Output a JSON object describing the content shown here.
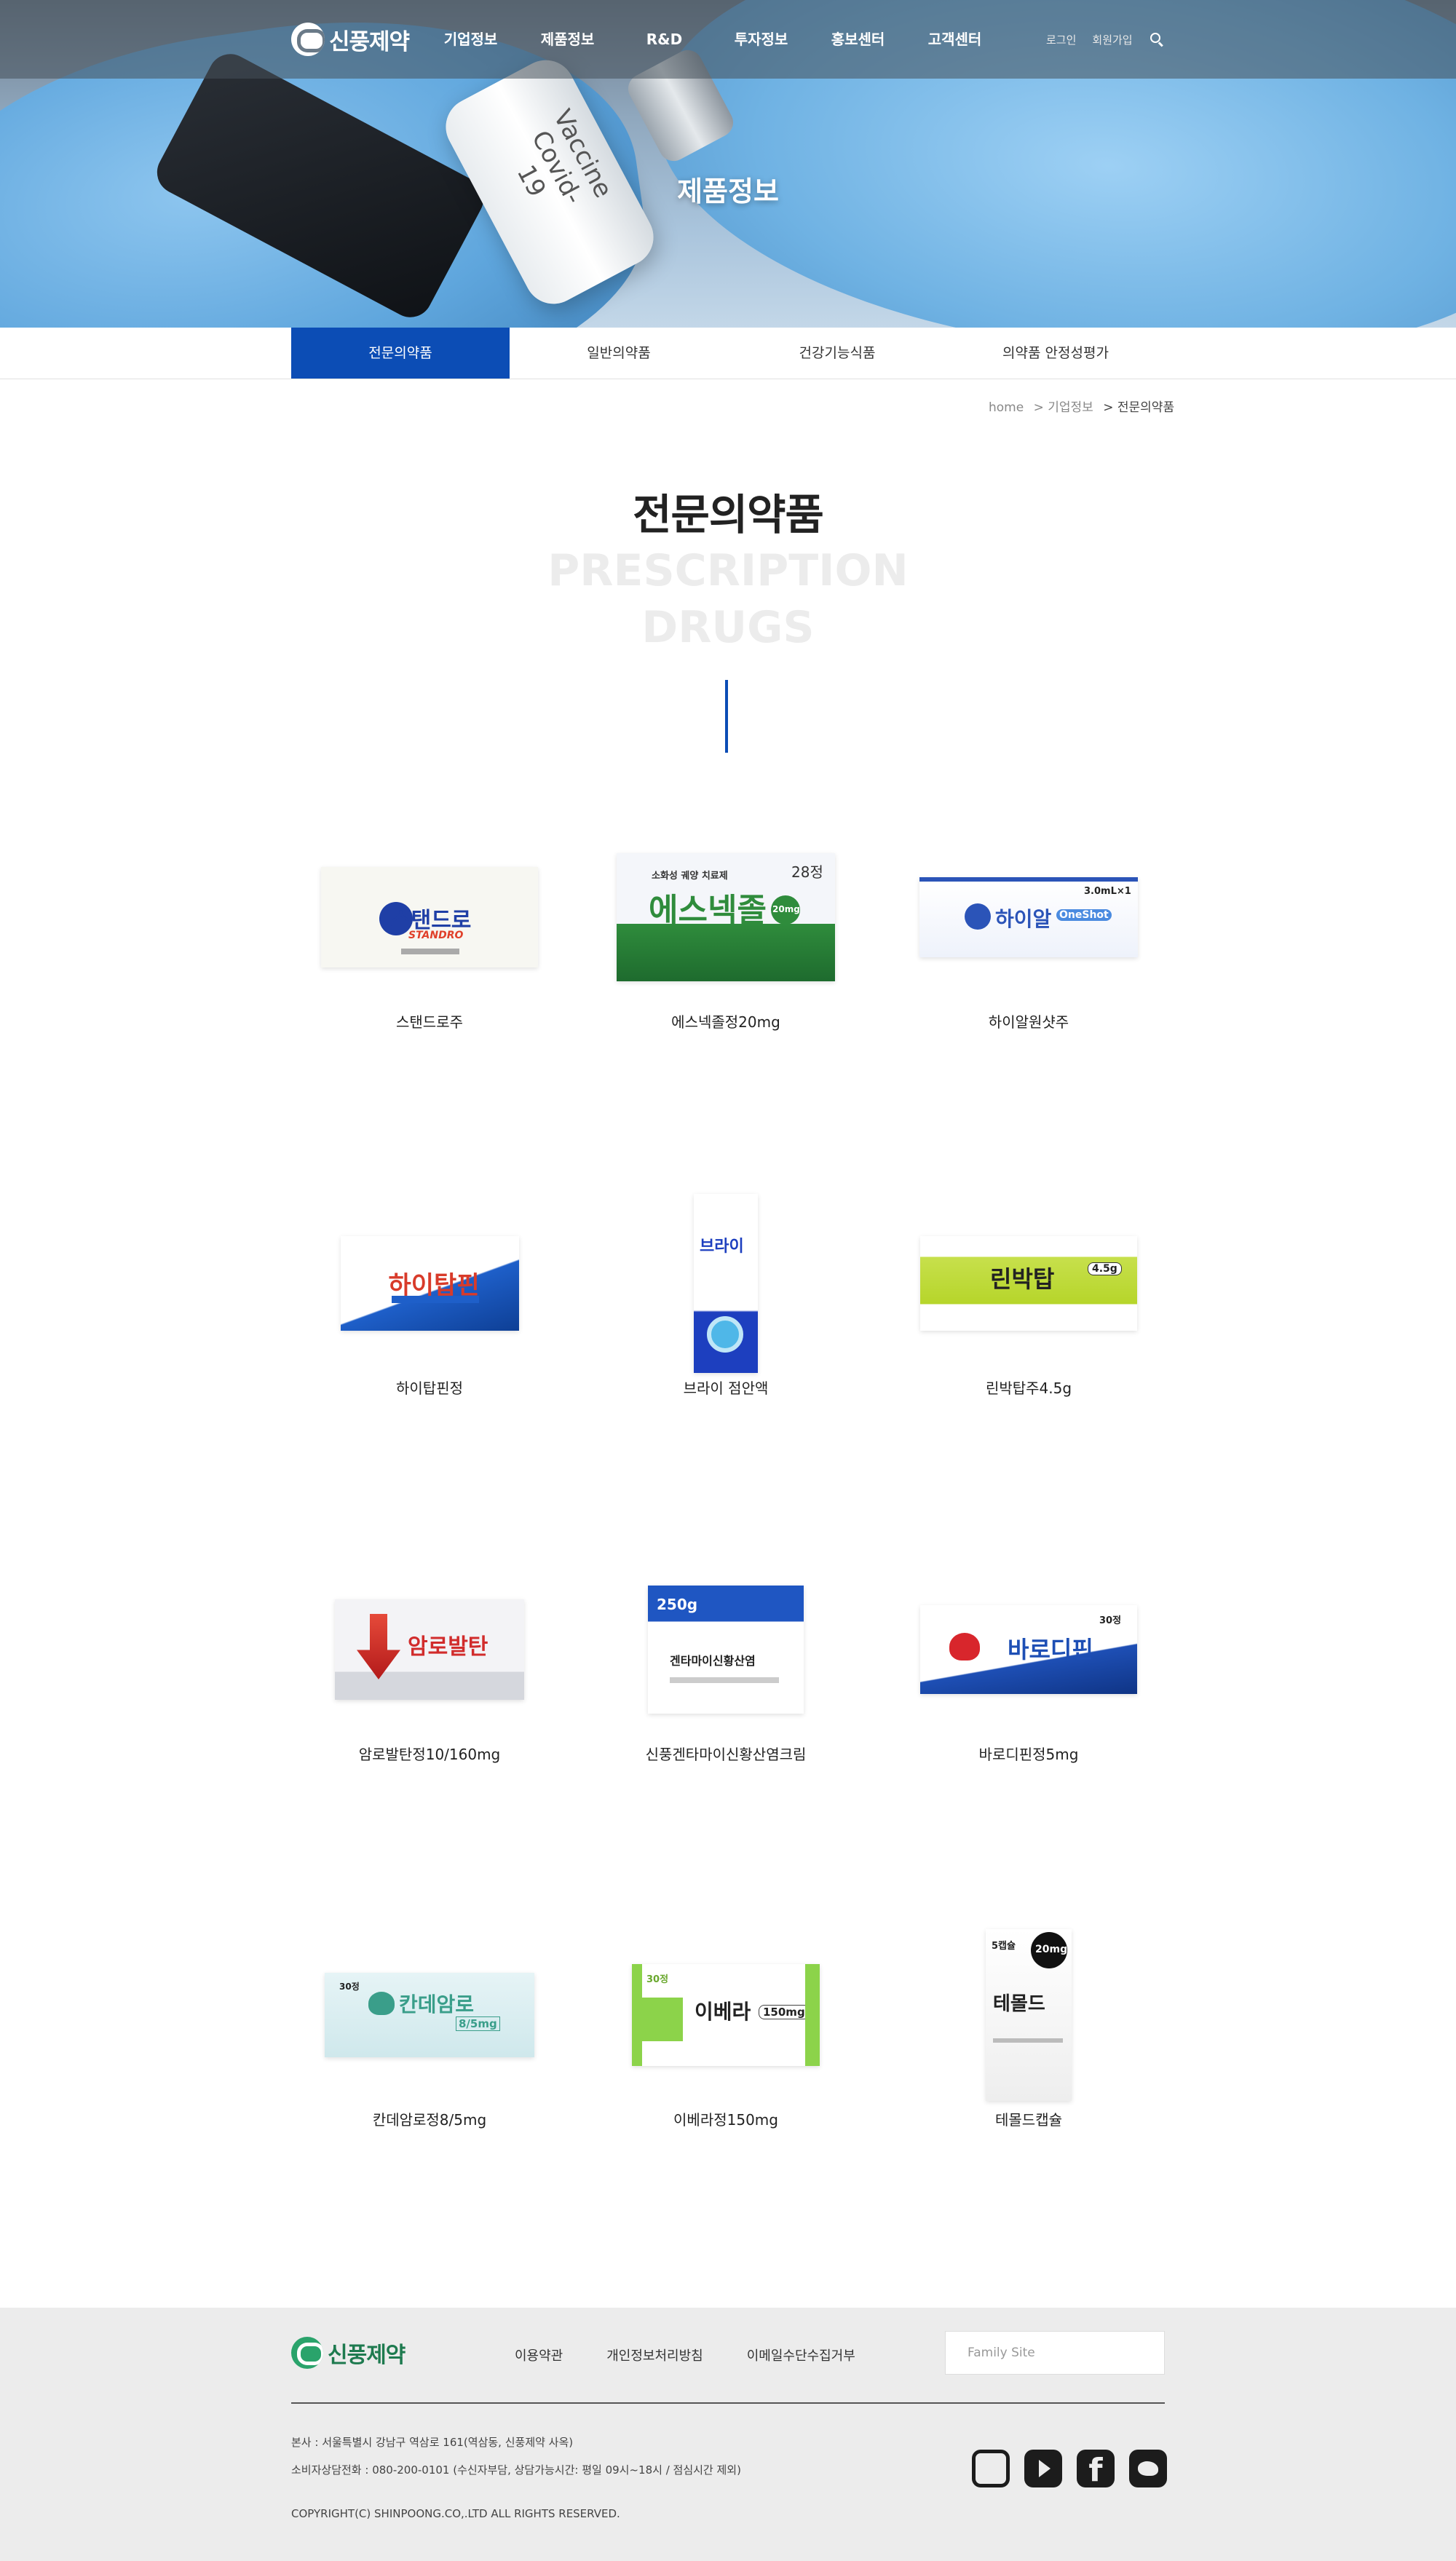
{
  "header": {
    "logo_text": "신풍제약",
    "nav": [
      "기업정보",
      "제품정보",
      "R&D",
      "투자정보",
      "홍보센터",
      "고객센터"
    ],
    "login": "로그인",
    "join": "회원가입"
  },
  "hero": {
    "title": "제품정보",
    "vial_text": "Vaccine Covid-19"
  },
  "subnav": {
    "tabs": [
      "전문의약품",
      "일반의약품",
      "건강기능식품",
      "의약품 안정성평가"
    ],
    "active_index": 0
  },
  "breadcrumb": {
    "home": "home",
    "level1": "> 기업정보",
    "current": "> 전문의약품"
  },
  "page": {
    "title": "전문의약품",
    "subtitle_line1": "PRESCRIPTION",
    "subtitle_line2": "DRUGS"
  },
  "products": [
    {
      "name": "스탠드로주",
      "pack_text": "스탠드로",
      "pack_sub": "STANDRO",
      "accent": "#1f3fa6"
    },
    {
      "name": "에스넥졸정20mg",
      "pack_text": "에스넥졸",
      "pack_sub": "소화성 궤양 치료제",
      "pack_badge": "20mg",
      "pack_count": "28정",
      "accent": "#2f8c3c"
    },
    {
      "name": "하이알원샷주",
      "pack_text": "하이알",
      "pack_sub": "OneShot",
      "pack_badge": "3.0mL×1",
      "accent": "#2b54b8"
    },
    {
      "name": "하이탑핀정",
      "pack_text": "하이탑핀",
      "accent": "#d83b2a"
    },
    {
      "name": "브라이 점안액",
      "pack_text": "브라이",
      "accent": "#1d3fbf"
    },
    {
      "name": "린박탑주4.5g",
      "pack_text": "린박탑",
      "pack_badge": "4.5g",
      "accent": "#b6d52a"
    },
    {
      "name": "암로발탄정10/160mg",
      "pack_text": "암로발탄",
      "accent": "#d12c2c"
    },
    {
      "name": "신풍겐타마이신황산염크림",
      "pack_text": "겐타마이신황산염",
      "pack_badge": "250g",
      "accent": "#1f56c2"
    },
    {
      "name": "바로디핀정5mg",
      "pack_text": "바로디핀",
      "pack_count": "30정",
      "accent": "#1e4fb5"
    },
    {
      "name": "칸데암로정8/5mg",
      "pack_text": "칸데암로",
      "pack_badge": "8/5mg",
      "pack_count": "30정",
      "accent": "#3a9e8a"
    },
    {
      "name": "이베라정150mg",
      "pack_text": "이베라",
      "pack_badge": "150mg",
      "pack_count": "30정",
      "accent": "#8cd34a"
    },
    {
      "name": "테몰드캡슐",
      "pack_text": "테몰드",
      "pack_badge": "20mg",
      "pack_count": "5캡슐",
      "accent": "#111111"
    }
  ],
  "footer": {
    "logo_text": "신풍제약",
    "links": [
      "이용약관",
      "개인정보처리방침",
      "이메일수단수집거부"
    ],
    "family_site": "Family Site",
    "address": "본사 : 서울특별시 강남구 역삼로 161(역삼동, 신풍제약 사옥)",
    "phone": "소비자상담전화 : 080-200-0101 (수신자부담, 상담가능시간: 평일 09시~18시 / 점심시간 제외)",
    "copyright": "COPYRIGHT(C) SHINPOONG.CO,.LTD ALL RIGHTS RESERVED.",
    "sns": [
      "instagram-icon",
      "youtube-icon",
      "facebook-icon",
      "twitter-icon"
    ]
  }
}
